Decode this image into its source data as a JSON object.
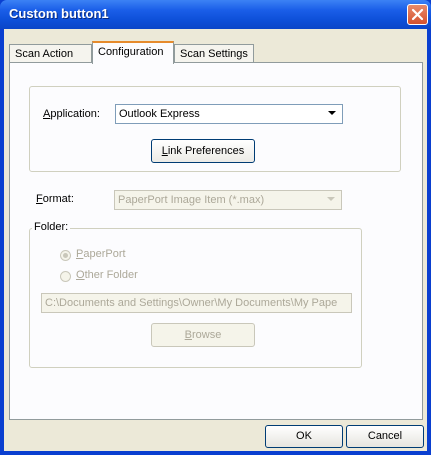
{
  "window": {
    "title": "Custom button1"
  },
  "tabs": [
    {
      "label": "Scan Action",
      "active": false
    },
    {
      "label": "Configuration",
      "active": true
    },
    {
      "label": "Scan Settings",
      "active": false
    }
  ],
  "application": {
    "label_prefix": "A",
    "label_rest": "pplication:",
    "value": "Outlook Express",
    "link_button": {
      "underline": "L",
      "rest": "ink Preferences"
    }
  },
  "format": {
    "label_prefix": "F",
    "label_rest": "ormat:",
    "value": "PaperPort Image Item (*.max)",
    "enabled": false
  },
  "folder": {
    "label": "Folder:",
    "options": [
      {
        "underline": "P",
        "rest": "aperPort",
        "selected": true
      },
      {
        "underline": "O",
        "rest": "ther Folder",
        "selected": false
      }
    ],
    "path": "C:\\Documents and Settings\\Owner\\My Documents\\My Pape",
    "browse": {
      "underline": "B",
      "rest": "rowse"
    },
    "enabled": false
  },
  "buttons": {
    "ok": "OK",
    "cancel": "Cancel"
  },
  "colors": {
    "titlebar": "#0d4fd8",
    "dialog_bg": "#ece9d8",
    "active_tab_accent": "#e68b2c",
    "disabled_text": "#aca899"
  }
}
